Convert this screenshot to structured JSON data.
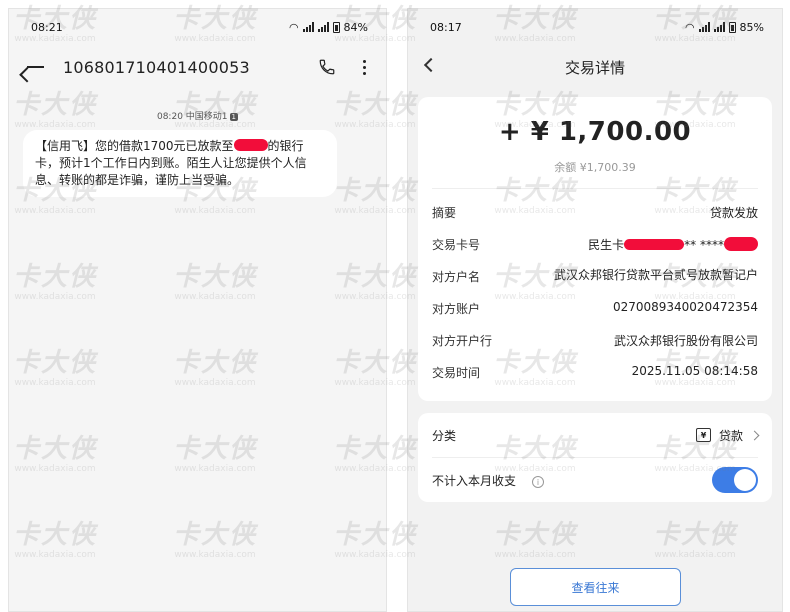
{
  "watermark": {
    "brand": "卡大侠",
    "site": "www.kadaxia.com"
  },
  "sms_screen": {
    "status_time": "08:21",
    "battery": "84%",
    "sender_number": "106801710401400053",
    "message_time": "08:20",
    "carrier": "中国移动1",
    "sim_badge": "1",
    "message_before": "【信用飞】您的借款1700元已放款至",
    "message_after": "的银行卡，预计1个工作日内到账。陌生人让您提供个人信息、转账的都是诈骗，谨防上当受骗。"
  },
  "tx_screen": {
    "status_time": "08:17",
    "battery": "85%",
    "title": "交易详情",
    "amount": "+ ¥ 1,700.00",
    "balance": "余额 ¥1,700.39",
    "rows": {
      "summary_label": "摘要",
      "summary_value": "贷款发放",
      "card_label": "交易卡号",
      "card_value_prefix": "民生卡",
      "card_value_mid": "** ****",
      "party_name_label": "对方户名",
      "party_name_value": "武汉众邦银行贷款平台贰号放款暂记户",
      "party_account_label": "对方账户",
      "party_account_value": "0270089340020472354",
      "party_bank_label": "对方开户行",
      "party_bank_value": "武汉众邦银行股份有限公司",
      "time_label": "交易时间",
      "time_value": "2025.11.05 08:14:58"
    },
    "category_label": "分类",
    "category_icon_glyph": "¥",
    "category_value": "贷款",
    "exclude_label": "不计入本月收支",
    "info_glyph": "i",
    "exclude_toggle_on": true,
    "history_button": "查看往来",
    "accent_color": "#3d7de6"
  }
}
